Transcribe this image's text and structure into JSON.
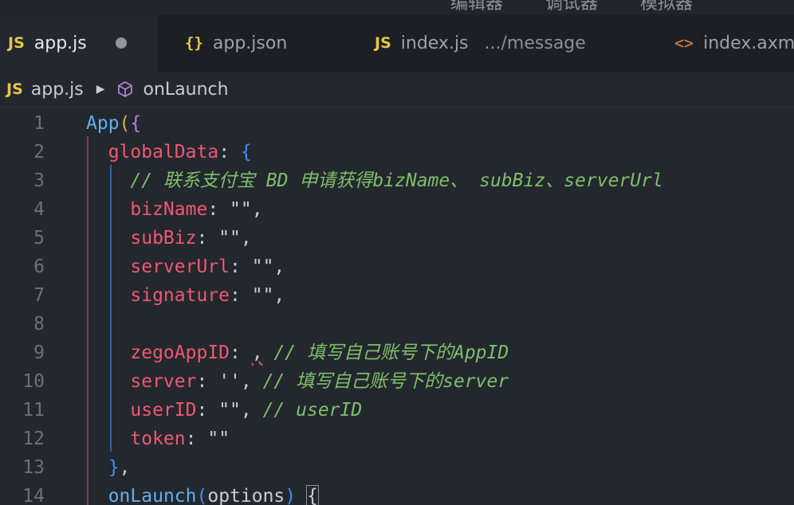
{
  "top_toolbar": {
    "items": [
      "编辑器",
      "调试器",
      "模拟器"
    ]
  },
  "tabs": [
    {
      "icon": "JS",
      "label": "app.js",
      "active": true,
      "modified": true
    },
    {
      "icon": "{}",
      "label": "app.json",
      "active": false
    },
    {
      "icon": "JS",
      "label": "index.js",
      "desc": ".../message",
      "active": false
    },
    {
      "icon": "<>",
      "label": "index.axml",
      "active": false
    }
  ],
  "breadcrumb": {
    "file_icon": "JS",
    "file": "app.js",
    "symbol": "onLaunch"
  },
  "code_lines": [
    {
      "n": "1",
      "tokens": [
        [
          "c-fn",
          "App"
        ],
        [
          "c-br1",
          "("
        ],
        [
          "c-br2",
          "{"
        ]
      ]
    },
    {
      "n": "2",
      "tokens": [
        [
          "c-plain",
          "  "
        ],
        [
          "c-key",
          "globalData"
        ],
        [
          "c-pun",
          ": "
        ],
        [
          "c-br3",
          "{"
        ]
      ]
    },
    {
      "n": "3",
      "tokens": [
        [
          "c-plain",
          "    "
        ],
        [
          "c-com",
          "// 联系支付宝 BD 申请获得bizName、 subBiz、serverUrl"
        ]
      ]
    },
    {
      "n": "4",
      "tokens": [
        [
          "c-plain",
          "    "
        ],
        [
          "c-key",
          "bizName"
        ],
        [
          "c-pun",
          ": "
        ],
        [
          "c-plain",
          "\"\","
        ]
      ]
    },
    {
      "n": "5",
      "tokens": [
        [
          "c-plain",
          "    "
        ],
        [
          "c-key",
          "subBiz"
        ],
        [
          "c-pun",
          ": "
        ],
        [
          "c-plain",
          "\"\","
        ]
      ]
    },
    {
      "n": "6",
      "tokens": [
        [
          "c-plain",
          "    "
        ],
        [
          "c-key",
          "serverUrl"
        ],
        [
          "c-pun",
          ": "
        ],
        [
          "c-plain",
          "\"\","
        ]
      ]
    },
    {
      "n": "7",
      "tokens": [
        [
          "c-plain",
          "    "
        ],
        [
          "c-key",
          "signature"
        ],
        [
          "c-pun",
          ": "
        ],
        [
          "c-plain",
          "\"\","
        ]
      ]
    },
    {
      "n": "8",
      "tokens": []
    },
    {
      "n": "9",
      "tokens": [
        [
          "c-plain",
          "    "
        ],
        [
          "c-key",
          "zegoAppID"
        ],
        [
          "c-pun",
          ": "
        ],
        [
          "squiggle",
          ","
        ],
        [
          "c-plain",
          " "
        ],
        [
          "c-com",
          "// 填写自己账号下的AppID"
        ]
      ]
    },
    {
      "n": "10",
      "tokens": [
        [
          "c-plain",
          "    "
        ],
        [
          "c-key",
          "server"
        ],
        [
          "c-pun",
          ": "
        ],
        [
          "c-plain",
          "'', "
        ],
        [
          "c-com",
          "// 填写自己账号下的server"
        ]
      ]
    },
    {
      "n": "11",
      "tokens": [
        [
          "c-plain",
          "    "
        ],
        [
          "c-key",
          "userID"
        ],
        [
          "c-pun",
          ": "
        ],
        [
          "c-plain",
          "\"\", "
        ],
        [
          "c-com",
          "// userID"
        ]
      ]
    },
    {
      "n": "12",
      "tokens": [
        [
          "c-plain",
          "    "
        ],
        [
          "c-key",
          "token"
        ],
        [
          "c-pun",
          ": "
        ],
        [
          "c-plain",
          "\"\""
        ]
      ]
    },
    {
      "n": "13",
      "tokens": [
        [
          "c-plain",
          "  "
        ],
        [
          "c-br3",
          "}"
        ],
        [
          "c-plain",
          ","
        ]
      ]
    },
    {
      "n": "14",
      "tokens": [
        [
          "c-plain",
          "  "
        ],
        [
          "c-fn",
          "onLaunch"
        ],
        [
          "c-br3",
          "("
        ],
        [
          "c-plain",
          "options"
        ],
        [
          "c-br3",
          ")"
        ],
        [
          "c-plain",
          " "
        ],
        [
          "cursor-br",
          "{"
        ]
      ]
    }
  ],
  "colors": {
    "background": "#23272e",
    "keyword_red": "#ef596f",
    "function_blue": "#61afef",
    "comment_green": "#7fbf6a"
  }
}
